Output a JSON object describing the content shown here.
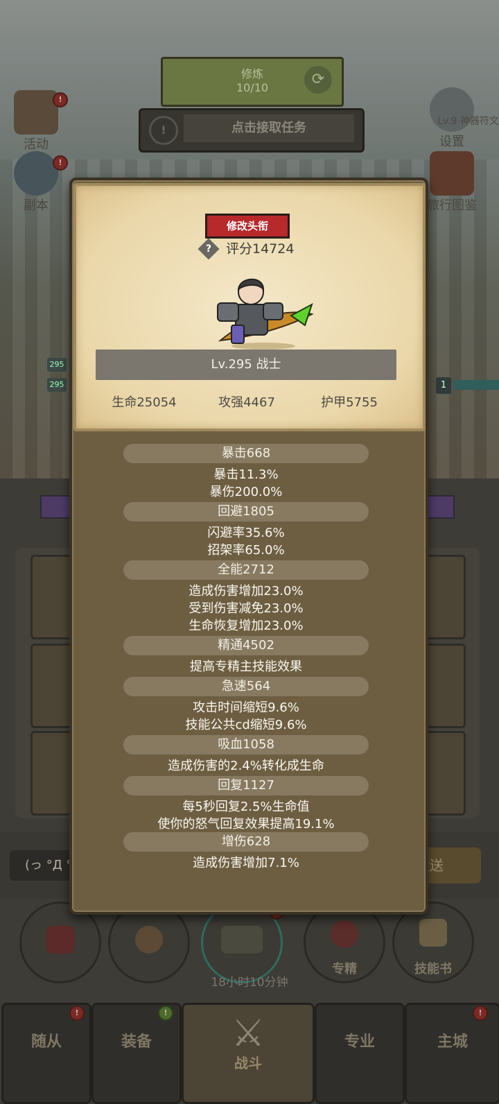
{
  "top": {
    "green_line1": "修炼",
    "green_line2": "10/10",
    "refresh_icon": "refresh-icon",
    "task_text": "点击接取任务",
    "task_icon": "!"
  },
  "side_icons": {
    "left_top": "活动",
    "left_mid": "副本",
    "right_top": "设置",
    "right_top_sub": "Lv.9 神器符文",
    "right_mid": "旅行图鉴"
  },
  "level_tags": [
    "295",
    "295",
    "1"
  ],
  "chat": {
    "input": "(っ °Д °",
    "send": "发送"
  },
  "circles": {
    "c5_label": "专精",
    "c6_label": "技能书"
  },
  "timer": "18小时10分钟",
  "nav": {
    "n1": "随从",
    "n2": "装备",
    "n3": "战斗",
    "n4": "专业",
    "n5": "主城"
  },
  "modal": {
    "title_button": "修改头衔",
    "score": "评分14724",
    "help_glyph": "?",
    "name_band": "Lv.295 战士",
    "hp": "生命25054",
    "atk": "攻强4467",
    "armor": "护甲5755",
    "sections": [
      {
        "head": "暴击668",
        "lines": [
          "暴击11.3%",
          "暴伤200.0%"
        ]
      },
      {
        "head": "回避1805",
        "lines": [
          "闪避率35.6%",
          "招架率65.0%"
        ]
      },
      {
        "head": "全能2712",
        "lines": [
          "造成伤害增加23.0%",
          "受到伤害减免23.0%",
          "生命恢复增加23.0%"
        ]
      },
      {
        "head": "精通4502",
        "lines": [
          "提高专精主技能效果"
        ]
      },
      {
        "head": "急速564",
        "lines": [
          "攻击时间缩短9.6%",
          "技能公共cd缩短9.6%"
        ]
      },
      {
        "head": "吸血1058",
        "lines": [
          "造成伤害的2.4%转化成生命"
        ]
      },
      {
        "head": "回复1127",
        "lines": [
          "每5秒回复2.5%生命值",
          "使你的怒气回复效果提高19.1%"
        ]
      },
      {
        "head": "增伤628",
        "lines": [
          "造成伤害增加7.1%"
        ]
      }
    ]
  },
  "colors": {
    "title_button": "#b8292b",
    "parchment": "#efe0ba",
    "modal_bg": "#6d5e42"
  }
}
